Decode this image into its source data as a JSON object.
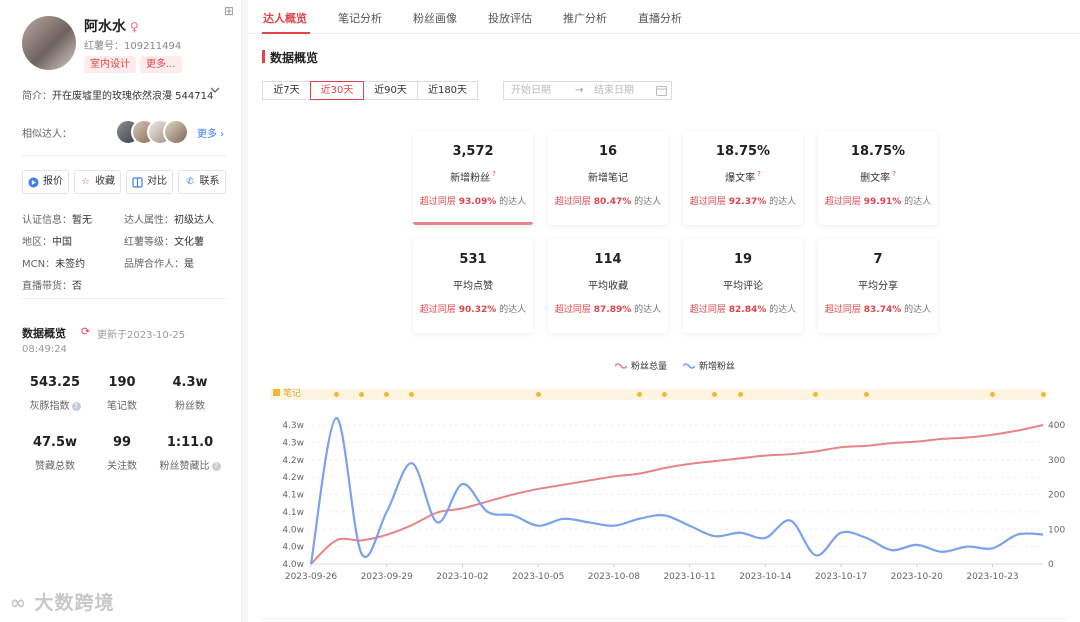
{
  "profile": {
    "name": "阿水水",
    "gender_icon": "♀",
    "red_id_label": "红薯号：",
    "red_id": "109211494",
    "tags": [
      "室内设计",
      "更多..."
    ],
    "bio_label": "简介：",
    "bio": "开在废墟里的玫瑰依然浪漫 544714",
    "similar_label": "相似达人：",
    "more": "更多",
    "colors": {
      "accent": "#e0454b",
      "link": "#3d7bf0"
    }
  },
  "actions": [
    {
      "label": "报价",
      "icon": "quote-icon"
    },
    {
      "label": "收藏",
      "icon": "star-icon"
    },
    {
      "label": "对比",
      "icon": "compare-icon"
    },
    {
      "label": "联系",
      "icon": "phone-icon"
    }
  ],
  "info": [
    {
      "k": "认证信息：",
      "v": "暂无"
    },
    {
      "k": "达人属性：",
      "v": "初级达人"
    },
    {
      "k": "地区：",
      "v": "中国"
    },
    {
      "k": "红薯等级：",
      "v": "文化薯"
    },
    {
      "k": "MCN：",
      "v": "未签约"
    },
    {
      "k": "品牌合作人：",
      "v": "是"
    },
    {
      "k": "直播带货：",
      "v": "否"
    }
  ],
  "side_overview": {
    "title": "数据概览",
    "updated": "更新于2023-10-25",
    "updated_time": "08:49:24",
    "stats": [
      {
        "value": "543.25",
        "label": "灰豚指数"
      },
      {
        "value": "190",
        "label": "笔记数"
      },
      {
        "value": "4.3w",
        "label": "粉丝数"
      },
      {
        "value": "47.5w",
        "label": "赞藏总数"
      },
      {
        "value": "99",
        "label": "关注数"
      },
      {
        "value": "1:11.0",
        "label": "粉丝赞藏比"
      }
    ]
  },
  "watermark": "大数跨境",
  "tabs": [
    "达人概览",
    "笔记分析",
    "粉丝画像",
    "投放评估",
    "推广分析",
    "直播分析"
  ],
  "main_title": "数据概览",
  "ranges": [
    "近7天",
    "近30天",
    "近90天",
    "近180天"
  ],
  "active_range": 1,
  "date": {
    "start": "开始日期",
    "arrow": "→",
    "end": "结束日期"
  },
  "cards": [
    {
      "value": "3,572",
      "label": "新增粉丝",
      "prefix": "超过同层",
      "pct": "93.09%",
      "suffix": " 的达人",
      "q": "?"
    },
    {
      "value": "16",
      "label": "新增笔记",
      "prefix": "超过同层",
      "pct": "80.47%",
      "suffix": " 的达人"
    },
    {
      "value": "18.75%",
      "label": "爆文率",
      "prefix": "超过同层",
      "pct": "92.37%",
      "suffix": " 的达人",
      "q": "?"
    },
    {
      "value": "18.75%",
      "label": "删文率",
      "prefix": "超过同层",
      "pct": "99.91%",
      "suffix": " 的达人",
      "q": "?"
    },
    {
      "value": "531",
      "label": "平均点赞",
      "prefix": "超过同层",
      "pct": "90.32%",
      "suffix": " 的达人"
    },
    {
      "value": "114",
      "label": "平均收藏",
      "prefix": "超过同层",
      "pct": "87.89%",
      "suffix": " 的达人"
    },
    {
      "value": "19",
      "label": "平均评论",
      "prefix": "超过同层",
      "pct": "82.84%",
      "suffix": " 的达人"
    },
    {
      "value": "7",
      "label": "平均分享",
      "prefix": "超过同层",
      "pct": "83.74%",
      "suffix": " 的达人"
    }
  ],
  "chart_data": {
    "type": "line",
    "notes_label": "笔记",
    "note_days": [
      1,
      2,
      3,
      4,
      9,
      13,
      14,
      16,
      17,
      20,
      22,
      27,
      29
    ],
    "x_labels": [
      "2023-09-26",
      "2023-09-29",
      "2023-10-02",
      "2023-10-05",
      "2023-10-08",
      "2023-10-11",
      "2023-10-14",
      "2023-10-17",
      "2023-10-20",
      "2023-10-23"
    ],
    "x_label_days": [
      0,
      3,
      6,
      9,
      12,
      15,
      18,
      21,
      24,
      27
    ],
    "left_ticks": [
      "4.0w",
      "4.0w",
      "4.0w",
      "4.1w",
      "4.1w",
      "4.2w",
      "4.2w",
      "4.3w",
      "4.3w"
    ],
    "right_ticks": [
      "0",
      "100",
      "200",
      "300",
      "400"
    ],
    "right_ylim": [
      0,
      400
    ],
    "series": [
      {
        "name": "粉丝总量",
        "color": "#e8838a",
        "axis": "left",
        "values": [
          0,
          0.17,
          0.17,
          0.21,
          0.28,
          0.37,
          0.4,
          0.45,
          0.5,
          0.54,
          0.57,
          0.6,
          0.63,
          0.65,
          0.69,
          0.72,
          0.74,
          0.76,
          0.78,
          0.79,
          0.81,
          0.84,
          0.85,
          0.87,
          0.88,
          0.9,
          0.91,
          0.93,
          0.96,
          1.0
        ]
      },
      {
        "name": "新增粉丝",
        "color": "#7aa2ee",
        "axis": "right",
        "values": [
          0,
          420,
          30,
          150,
          290,
          120,
          230,
          150,
          140,
          110,
          130,
          120,
          110,
          130,
          140,
          110,
          80,
          90,
          75,
          125,
          25,
          90,
          75,
          40,
          55,
          35,
          50,
          45,
          85,
          85
        ]
      }
    ]
  }
}
